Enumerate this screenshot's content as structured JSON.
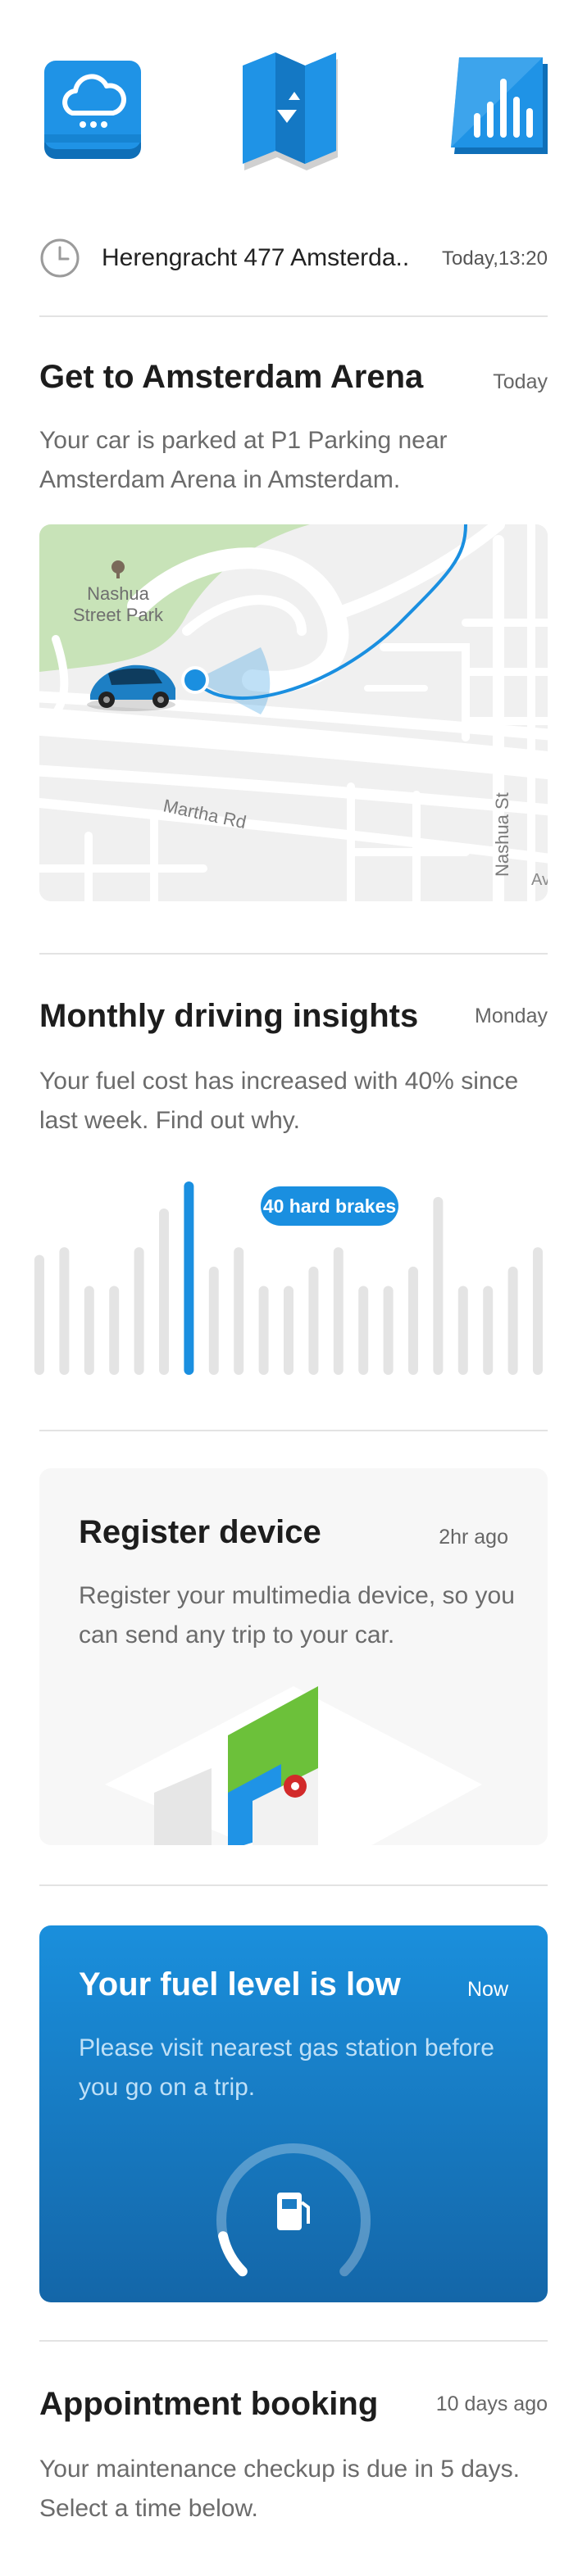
{
  "top_icons": [
    {
      "name": "weather-icon"
    },
    {
      "name": "map-icon"
    },
    {
      "name": "stats-icon"
    }
  ],
  "recent": {
    "address": "Herengracht 477 Amsterda..",
    "time": "Today,13:20"
  },
  "parking_card": {
    "title": "Get to Amsterdam Arena",
    "time": "Today",
    "body": "Your car is parked at P1 Parking near Amsterdam Arena in Amsterdam.",
    "map": {
      "park_label_1": "Nashua",
      "park_label_2": "Street Park",
      "road_label": "Martha Rd",
      "street_label": "Nashua St",
      "edge_label": "Av"
    }
  },
  "insights_card": {
    "title": "Monthly driving insights",
    "time": "Monday",
    "body": "Your fuel cost has increased with 40% since last week. Find out why.",
    "badge": "40 hard brakes",
    "bars": [
      0.62,
      0.66,
      0.46,
      0.46,
      0.66,
      0.86,
      1.0,
      0.56,
      0.66,
      0.46,
      0.46,
      0.56,
      0.66,
      0.46,
      0.46,
      0.56,
      0.92,
      0.46,
      0.46,
      0.56,
      0.66
    ],
    "highlight_index": 6,
    "colors": {
      "bar": "#e4e4e4",
      "highlight": "#1a8fe0"
    }
  },
  "device_card": {
    "title": "Register device",
    "time": "2hr ago",
    "body": "Register your multimedia device, so you can send any trip to your car."
  },
  "fuel_card": {
    "title": "Your fuel level is low",
    "time": "Now",
    "body": "Please visit nearest gas station before you go on a trip.",
    "level": 0.12
  },
  "appointment_card": {
    "title": "Appointment booking",
    "time": "10 days ago",
    "body": "Your maintenance checkup is due in 5 days. Select a time below."
  }
}
